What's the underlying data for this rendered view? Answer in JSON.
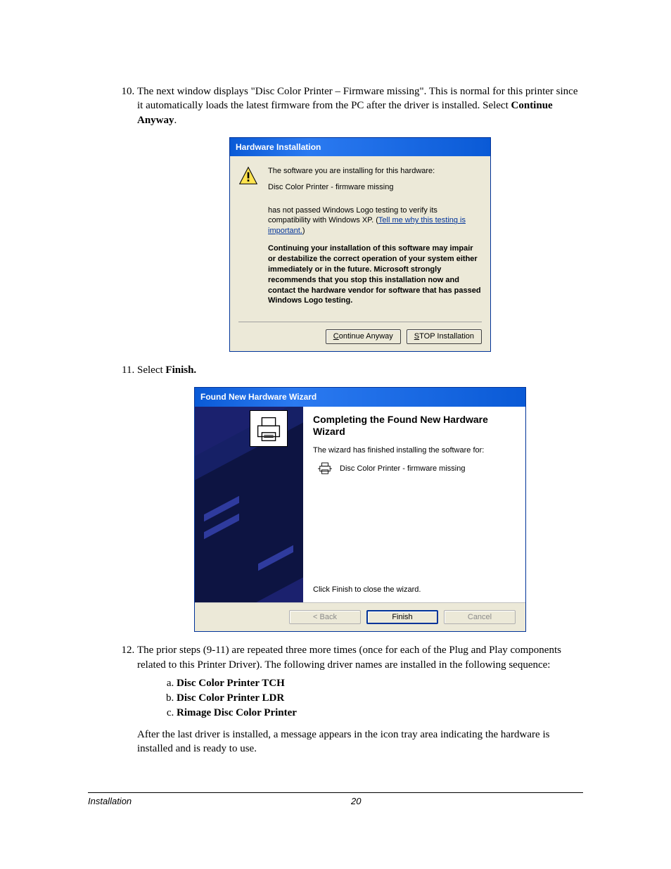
{
  "step10": {
    "num": "10.",
    "text_before": "The next window displays \"Disc Color Printer – Firmware missing\". This is normal for this printer since it automatically loads the latest firmware from the PC after the driver is installed. Select ",
    "bold": "Continue Anyway",
    "text_after": "."
  },
  "dlg1": {
    "title": "Hardware Installation",
    "line1": "The software you are installing for this hardware:",
    "device": "Disc Color Printer - firmware missing",
    "logo_prefix": "has not passed Windows Logo testing to verify its compatibility with Windows XP. (",
    "logo_link": "Tell me why this testing is important.",
    "logo_suffix": ")",
    "warn": "Continuing your installation of this software may impair or destabilize the correct operation of your system either immediately or in the future. Microsoft strongly recommends that you stop this installation now and contact the hardware vendor for software that has passed Windows Logo testing.",
    "btn_continue": "Continue Anyway",
    "btn_stop_pre": "S",
    "btn_stop_rest": "TOP Installation",
    "btn_continue_u": "C"
  },
  "step11": {
    "text": "Select ",
    "bold": "Finish."
  },
  "dlg2": {
    "title": "Found New Hardware Wizard",
    "heading": "Completing the Found New Hardware Wizard",
    "sub": "The wizard has finished installing the software for:",
    "device": "Disc Color Printer - firmware missing",
    "closehint": "Click Finish to close the wizard.",
    "btn_back": "< Back",
    "btn_finish": "Finish",
    "btn_cancel": "Cancel"
  },
  "step12": {
    "text": "The prior steps (9-11) are repeated three more times (once for each of the Plug and Play components related to this Printer Driver).  The following driver names are installed in the following sequence:",
    "items": [
      "Disc Color Printer TCH",
      "Disc Color Printer LDR",
      "Rimage Disc Color Printer"
    ],
    "after": "After the last driver is installed, a message appears in the icon tray area indicating the hardware is installed and is ready to use."
  },
  "footer": {
    "section": "Installation",
    "page_num": "20"
  }
}
